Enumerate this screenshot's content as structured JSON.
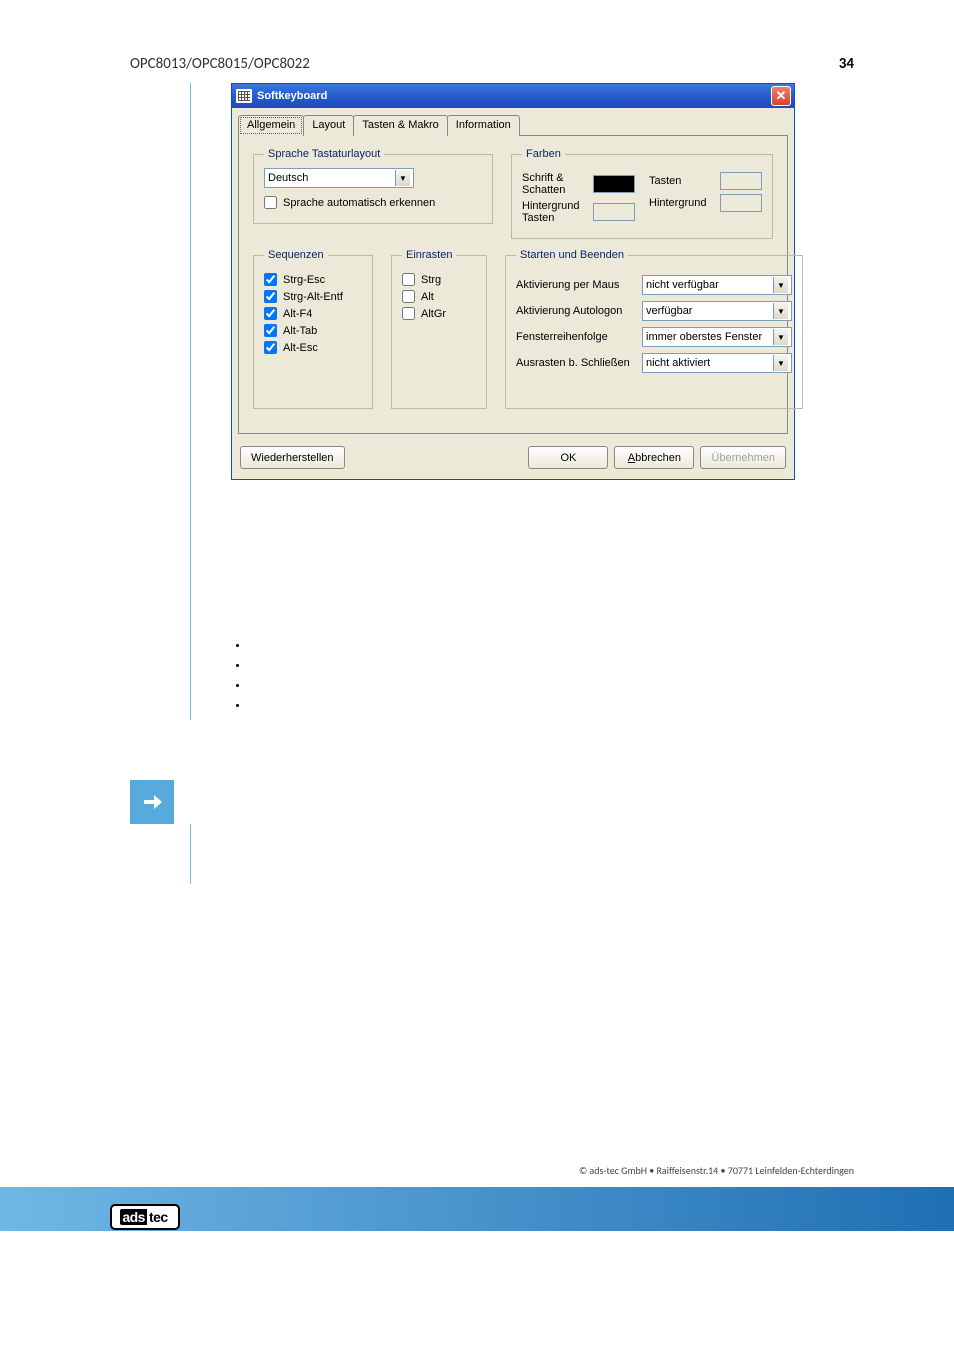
{
  "header": {
    "left": "OPC8013/OPC8015/OPC8022",
    "right": "34"
  },
  "window": {
    "title": "Softkeyboard",
    "tabs": [
      "Allgemein",
      "Layout",
      "Tasten & Makro",
      "Information"
    ],
    "active_tab": 0,
    "group_sprache": {
      "legend": "Sprache Tastaturlayout",
      "language": "Deutsch",
      "auto_detect_label": "Sprache automatisch erkennen",
      "auto_detect_checked": false
    },
    "group_farben": {
      "legend": "Farben",
      "rows": [
        {
          "label": "Schrift & Schatten",
          "color": "#000000"
        },
        {
          "label": "Tasten",
          "color": "#ece9d8"
        },
        {
          "label": "Hintergrund Tasten",
          "color": "#ece9d8"
        },
        {
          "label": "Hintergrund",
          "color": "#ece9d8"
        }
      ]
    },
    "group_sequenzen": {
      "legend": "Sequenzen",
      "items": [
        {
          "label": "Strg-Esc",
          "checked": true
        },
        {
          "label": "Strg-Alt-Entf",
          "checked": true
        },
        {
          "label": "Alt-F4",
          "checked": true
        },
        {
          "label": "Alt-Tab",
          "checked": true
        },
        {
          "label": "Alt-Esc",
          "checked": true
        }
      ]
    },
    "group_einrasten": {
      "legend": "Einrasten",
      "items": [
        {
          "label": "Strg",
          "checked": false
        },
        {
          "label": "Alt",
          "checked": false
        },
        {
          "label": "AltGr",
          "checked": false
        }
      ]
    },
    "group_startbeenden": {
      "legend": "Starten und Beenden",
      "rows": [
        {
          "label": "Aktivierung per Maus",
          "value": "nicht verfügbar"
        },
        {
          "label": "Aktivierung Autologon",
          "value": "verfügbar"
        },
        {
          "label": "Fensterreihenfolge",
          "value": "immer oberstes Fenster"
        },
        {
          "label": "Ausrasten b. Schließen",
          "value": "nicht aktiviert"
        }
      ]
    },
    "buttons": {
      "restore": "Wiederherstellen",
      "ok": "OK",
      "cancel": "Abbrechen",
      "apply": "Übernehmen"
    }
  },
  "footer": "© ads-tec GmbH • Raiffeisenstr.14 • 70771 Leinfelden-Echterdingen",
  "logo": {
    "a": "ads",
    "b": "tec"
  }
}
